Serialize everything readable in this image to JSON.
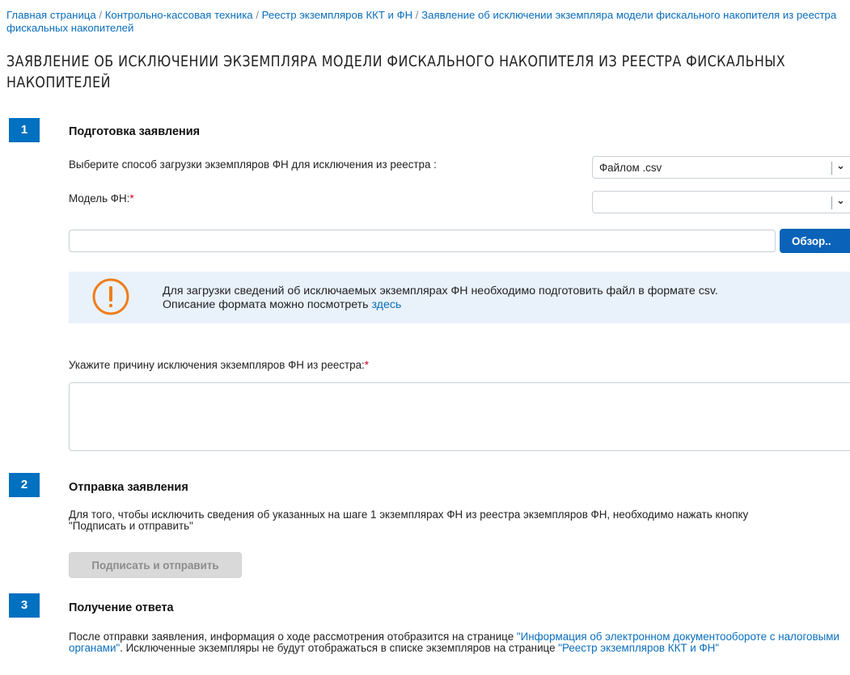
{
  "breadcrumb": {
    "items": [
      "Главная страница",
      "Контрольно-кассовая техника",
      "Реестр экземпляров ККТ и ФН",
      "Заявление об исключении экземпляра модели фискального накопителя из реестра фискальных накопителей"
    ],
    "separator": "/"
  },
  "page_title": "ЗАЯВЛЕНИЕ ОБ ИСКЛЮЧЕНИИ ЭКЗЕМПЛЯРА МОДЕЛИ ФИСКАЛЬНОГО НАКОПИТЕЛЯ ИЗ РЕЕСТРА ФИСКАЛЬНЫХ НАКОПИТЕЛЕЙ",
  "step1": {
    "number": "1",
    "title": "Подготовка заявления",
    "upload_method_label": "Выберите способ загрузки экземпляров ФН для исключения из реестра :",
    "upload_method_value": "Файлом .csv",
    "model_label": "Модель ФН:",
    "model_value": "",
    "required_mark": "*",
    "browse_label": "Обзор..",
    "notice_line1": "Для загрузки сведений об исключаемых экземплярах ФН необходимо подготовить файл в формате csv.",
    "notice_line2": "Описание формата можно посмотреть",
    "notice_link": "здесь",
    "reason_label": "Укажите причину исключения экземпляров ФН из реестра:"
  },
  "step2": {
    "number": "2",
    "title": "Отправка заявления",
    "text_line1": "Для того, чтобы исключить сведения об указанных на шаге 1 экземплярах ФН из реестра экземпляров ФН, необходимо нажать кнопку",
    "text_line2": "\"Подписать и отправить\"",
    "sign_button": "Подписать и отправить"
  },
  "step3": {
    "number": "3",
    "title": "Получение ответа",
    "text_part1": "После отправки заявления, информация о ходе рассмотрения отобразится на странице ",
    "link1": "\"Информация об электронном документообороте с налоговыми органами\"",
    "text_part2": ". Исключенные экземпляры не будут отображаться в списке экземпляров на странице ",
    "link2": "\"Реестр экземпляров ККТ и ФН\""
  },
  "colors": {
    "accent": "#0070c0",
    "link": "#0a6ebd",
    "required": "#d0021b",
    "warning": "#f07d1a",
    "notice_bg": "#e9f2fb"
  },
  "icons": {
    "warning": "exclamation-circle-icon",
    "dropdown": "chevron-down-icon"
  }
}
